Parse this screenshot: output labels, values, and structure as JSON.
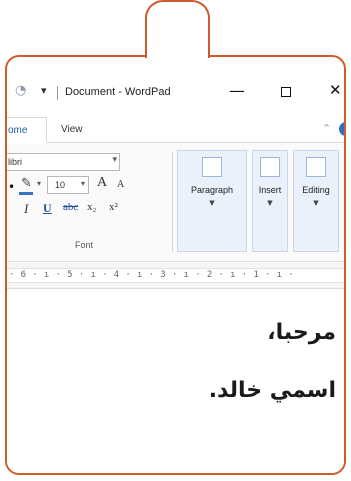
{
  "window": {
    "title": "Document - WordPad",
    "minimize_glyph": "—",
    "close_glyph": "✕"
  },
  "ribbon_tabs": {
    "home": "ome",
    "view": "View"
  },
  "font_group": {
    "font_name": "libri",
    "font_size": "10",
    "label": "Font",
    "grow_glyph": "A",
    "shrink_glyph": "A",
    "italic": "I",
    "underline": "U",
    "strike": "abc",
    "subscript": "x₂",
    "superscript": "x²"
  },
  "groups": {
    "paragraph": "Paragraph",
    "insert": "Insert",
    "editing": "Editing"
  },
  "ruler": "· 6 · ı · 5 · ı · 4 · ı · 3 · ı · 2 · ı · 1 · ı ·",
  "document": {
    "line1": "مرحبا،",
    "line2": "اسمي خالد."
  },
  "colors": {
    "frame_accent": "#cf5a2a",
    "group_highlight": "#eaf1fb"
  },
  "icons": [
    "app-icon",
    "quick-access-dropdown-icon",
    "minimize-icon",
    "maximize-icon",
    "close-icon",
    "help-icon",
    "font-color-icon",
    "paragraph-icon",
    "insert-picture-icon",
    "find-icon"
  ]
}
